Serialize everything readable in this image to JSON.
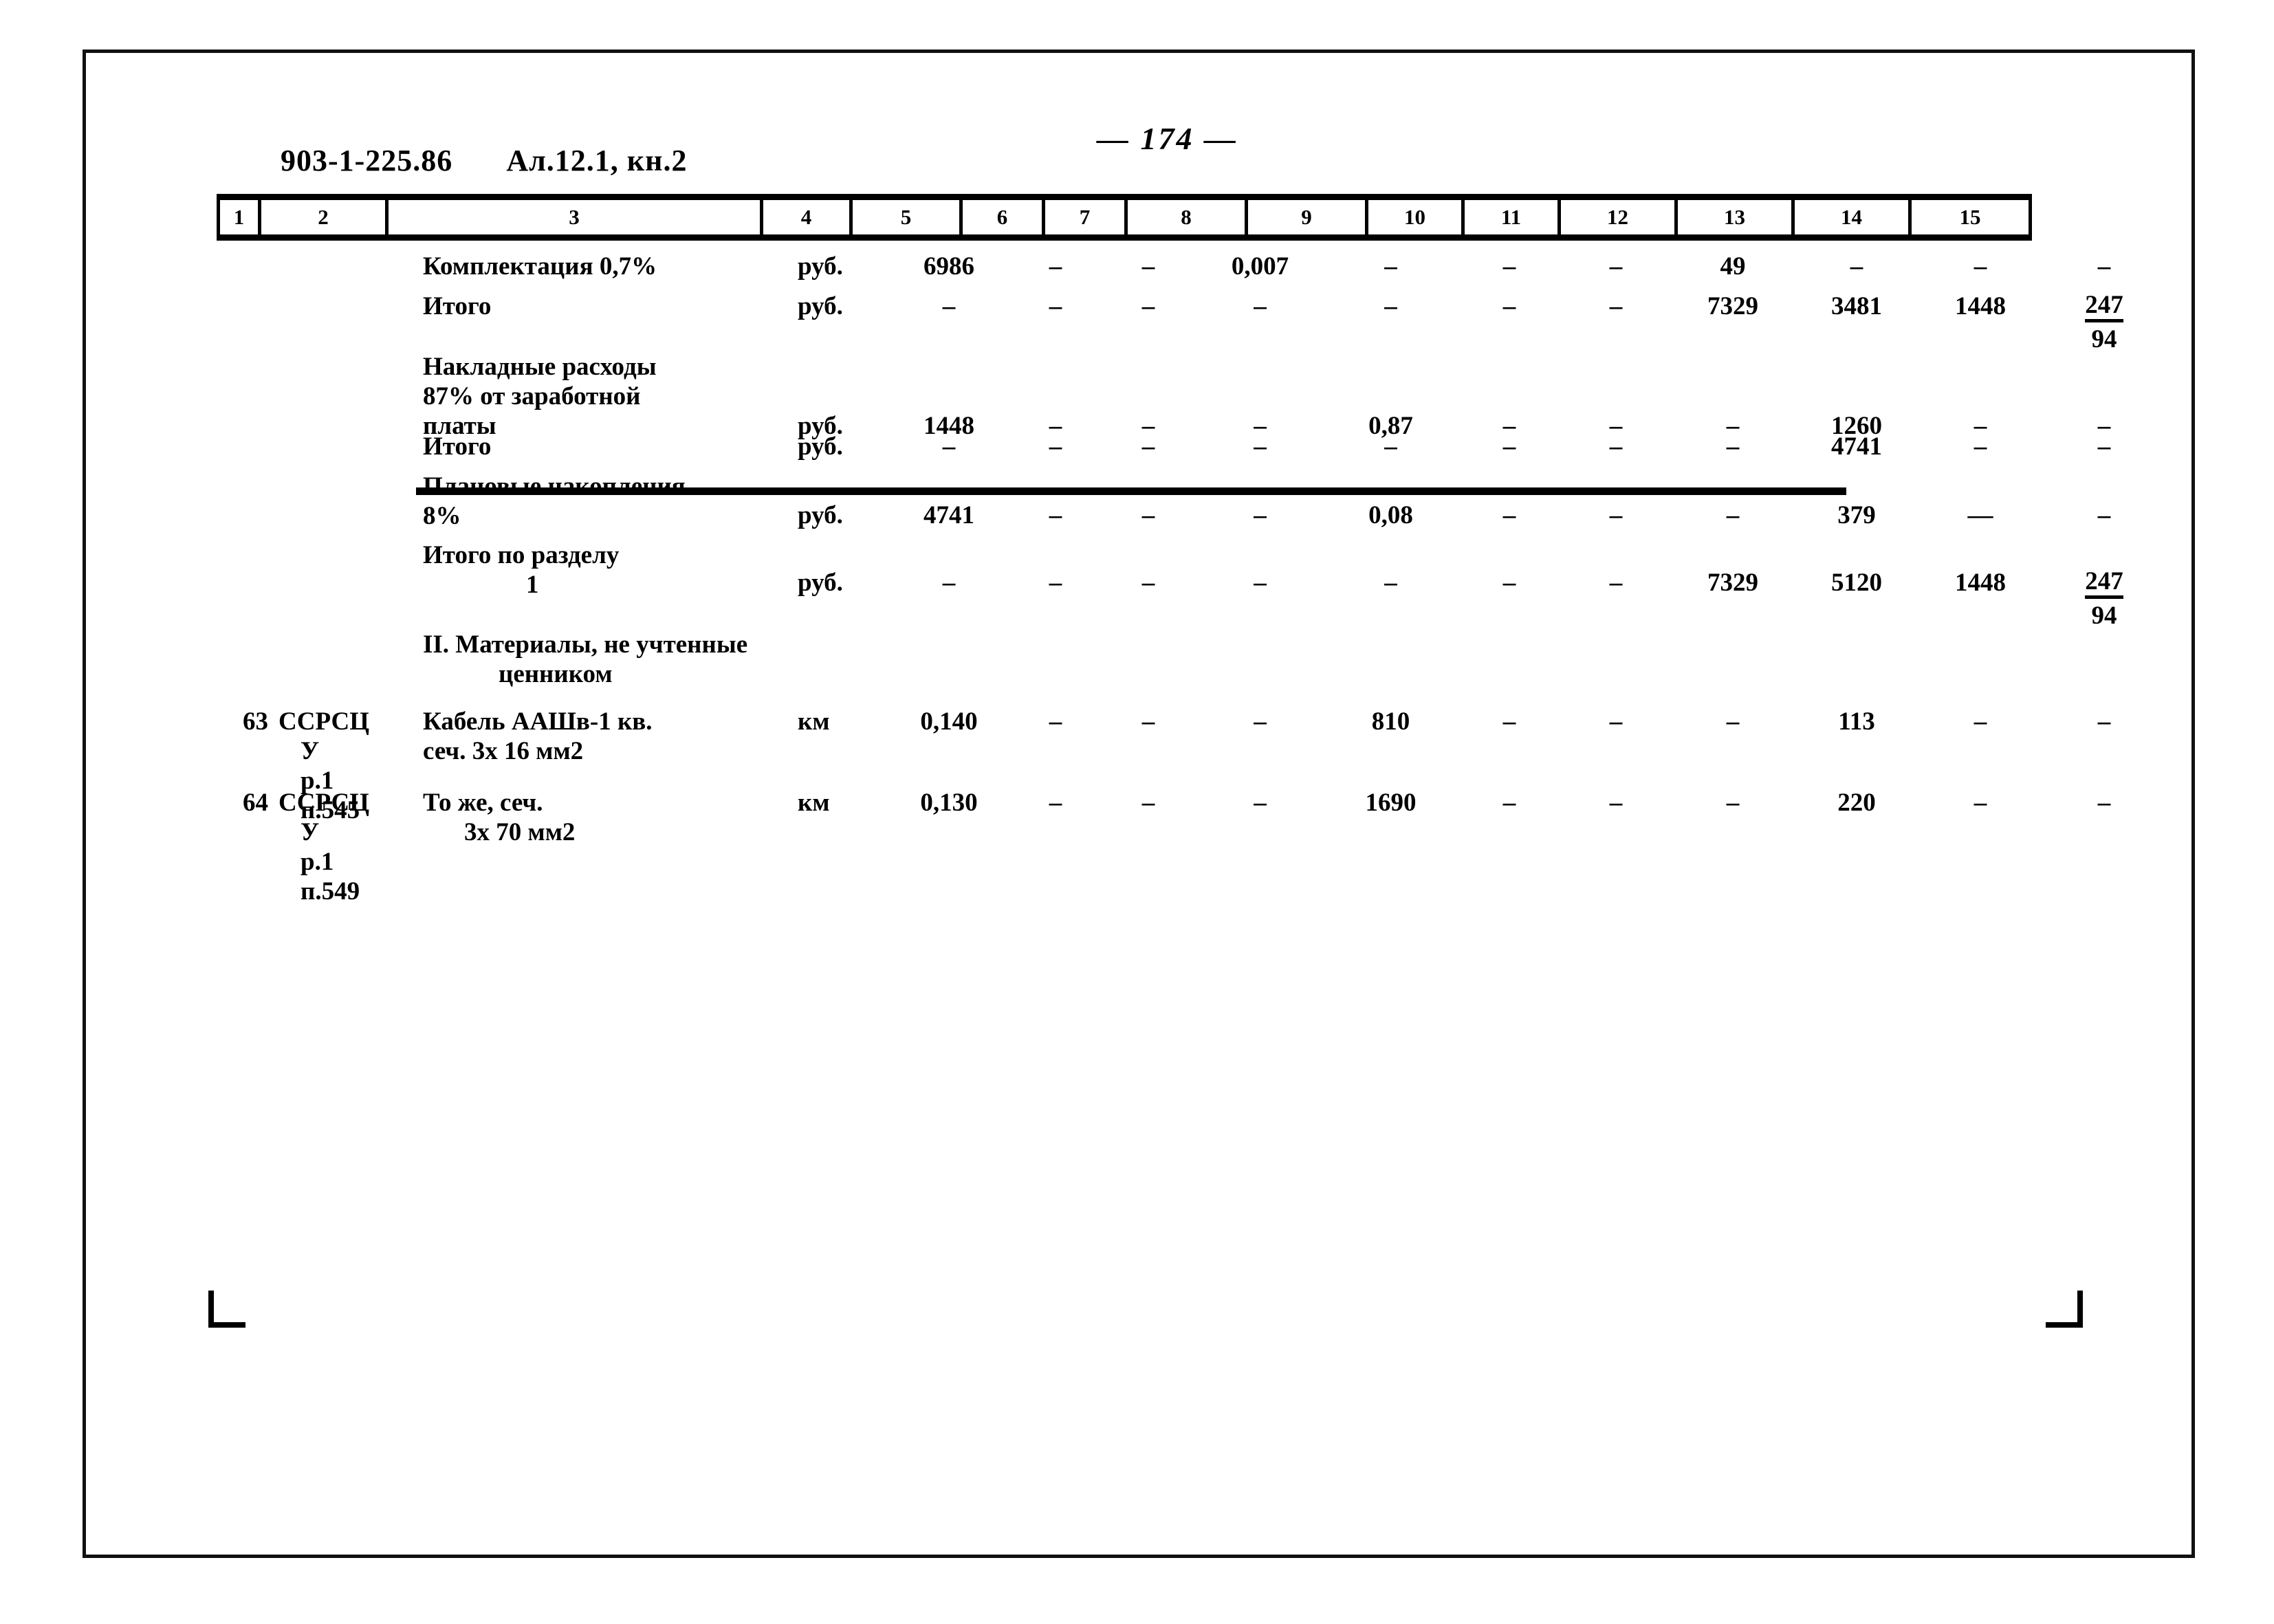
{
  "document": {
    "code": "903-1-225.86",
    "album": "Ал.12.1, кн.2",
    "page_number": "— 174 —"
  },
  "table": {
    "column_numbers": [
      "1",
      "2",
      "3",
      "4",
      "5",
      "6",
      "7",
      "8",
      "9",
      "10",
      "11",
      "12",
      "13",
      "14",
      "15"
    ],
    "rows": [
      {
        "name": "row-komplektaciya",
        "c1": "",
        "c2": "",
        "c3": "Комплектация 0,7%",
        "c4": "руб.",
        "c5": "6986",
        "c6": "–",
        "c7": "–",
        "c8": "0,007",
        "c9": "–",
        "c10": "–",
        "c11": "–",
        "c12": "49",
        "c13": "–",
        "c14": "–",
        "c15": "–"
      },
      {
        "name": "row-itogo-1",
        "c1": "",
        "c2": "",
        "c3": "Итого",
        "c4": "руб.",
        "c5": "–",
        "c6": "–",
        "c7": "–",
        "c8": "–",
        "c9": "–",
        "c10": "–",
        "c11": "–",
        "c12": "7329",
        "c13": "3481",
        "c14": "1448",
        "c15_fraction": {
          "numerator": "247",
          "denominator": "94"
        }
      },
      {
        "name": "row-nakladnye-rashody",
        "c1": "",
        "c2": "",
        "c3_lines": [
          "Накладные расходы",
          "87% от заработной",
          "платы"
        ],
        "c4": "руб.",
        "c5": "1448",
        "c6": "–",
        "c7": "–",
        "c8": "–",
        "c9": "0,87",
        "c10": "–",
        "c11": "–",
        "c12": "–",
        "c13": "1260",
        "c14": "–",
        "c15": "–"
      },
      {
        "name": "row-itogo-2",
        "c1": "",
        "c2": "",
        "c3": "Итого",
        "c4": "руб.",
        "c5": "–",
        "c6": "–",
        "c7": "–",
        "c8": "–",
        "c9": "–",
        "c10": "–",
        "c11": "–",
        "c12": "–",
        "c13": "4741",
        "c14": "–",
        "c15": "–"
      },
      {
        "name": "row-planovye-nakopleniya",
        "c1": "",
        "c2": "",
        "c3_lines": [
          "Плановые накопления",
          "8%"
        ],
        "c4": "руб.",
        "c5": "4741",
        "c6": "–",
        "c7": "–",
        "c8": "–",
        "c9": "0,08",
        "c10": "–",
        "c11": "–",
        "c12": "–",
        "c13": "379",
        "c14": "—",
        "c15": "–"
      },
      {
        "name": "row-itogo-po-razdelu",
        "c1": "",
        "c2": "",
        "c3_lines": [
          "Итого по разделу",
          "1"
        ],
        "c4": "руб.",
        "c5": "–",
        "c6": "–",
        "c7": "–",
        "c8": "–",
        "c9": "–",
        "c10": "–",
        "c11": "–",
        "c12": "7329",
        "c13": "5120",
        "c14": "1448",
        "c15_fraction": {
          "numerator": "247",
          "denominator": "94"
        }
      },
      {
        "name": "row-section-heading-2",
        "c1": "",
        "c2": "",
        "c3_lines": [
          "II. Материалы, не учтенные",
          "ценником"
        ],
        "c4": "",
        "c5": "",
        "c6": "",
        "c7": "",
        "c8": "",
        "c9": "",
        "c10": "",
        "c11": "",
        "c12": "",
        "c13": "",
        "c14": "",
        "c15": ""
      },
      {
        "name": "row-63",
        "c1": "63",
        "c2_lines": [
          "ССРСЦ",
          "У",
          "р.1",
          "п.545"
        ],
        "c3_lines": [
          "Кабель ААШв-1 кв.",
          "сеч. 3х 16 мм2"
        ],
        "c4": "км",
        "c5": "0,140",
        "c6": "–",
        "c7": "–",
        "c8": "–",
        "c9": "810",
        "c10": "–",
        "c11": "–",
        "c12": "–",
        "c13": "113",
        "c14": "–",
        "c15": "–"
      },
      {
        "name": "row-64",
        "c1": "64",
        "c2_lines": [
          "ССРСЦ",
          "У",
          "р.1",
          "п.549"
        ],
        "c3_lines": [
          "То же, сеч.",
          "3х 70 мм2"
        ],
        "c4": "км",
        "c5": "0,130",
        "c6": "–",
        "c7": "–",
        "c8": "–",
        "c9": "1690",
        "c10": "–",
        "c11": "–",
        "c12": "–",
        "c13": "220",
        "c14": "–",
        "c15": "–"
      }
    ]
  }
}
